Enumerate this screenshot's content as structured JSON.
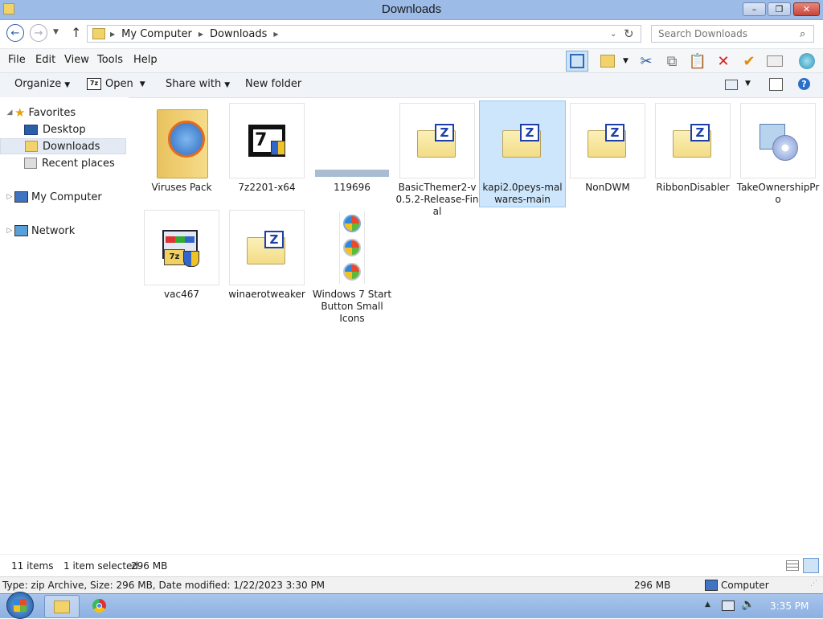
{
  "window": {
    "title": "Downloads",
    "controls": {
      "minimize": "–",
      "restore": "❐",
      "close": "✕"
    }
  },
  "address": {
    "crumbs": [
      "My Computer",
      "Downloads"
    ],
    "search_placeholder": "Search Downloads"
  },
  "menu": [
    "File",
    "Edit",
    "View",
    "Tools",
    "Help"
  ],
  "commands": {
    "organize": "Organize",
    "open": "Open",
    "share": "Share with",
    "new_folder": "New folder"
  },
  "nav": {
    "favorites": "Favorites",
    "desktop": "Desktop",
    "downloads": "Downloads",
    "recent": "Recent places",
    "computer": "My Computer",
    "network": "Network"
  },
  "files": [
    {
      "name": "Viruses Pack",
      "icon": "folder-browser-icon"
    },
    {
      "name": "7z2201-x64",
      "icon": "7zip-installer-icon"
    },
    {
      "name": "119696",
      "icon": "image-thumbnail-icon"
    },
    {
      "name": "BasicThemer2-v0.5.2-Release-Final",
      "icon": "zip-folder-icon"
    },
    {
      "name": "kapi2.0peys-malwares-main",
      "icon": "zip-folder-icon",
      "selected": true
    },
    {
      "name": "NonDWM",
      "icon": "zip-folder-icon"
    },
    {
      "name": "RibbonDisabler",
      "icon": "zip-folder-icon"
    },
    {
      "name": "TakeOwnershipPro",
      "icon": "setup-cd-icon"
    },
    {
      "name": "vac467",
      "icon": "7zip-app-icon"
    },
    {
      "name": "winaerotweaker",
      "icon": "zip-folder-icon"
    },
    {
      "name": "Windows 7 Start Button Small Icons",
      "icon": "start-orbs-icon"
    }
  ],
  "status": {
    "items": "11 items",
    "selected": "1 item selected",
    "size": "296 MB",
    "details": "Type: zip Archive, Size: 296 MB, Date modified: 1/22/2023 3:30 PM",
    "size2": "296 MB",
    "location": "Computer"
  },
  "taskbar": {
    "time": "3:35 PM"
  },
  "colors": {
    "selection": "#cde6fb",
    "titlebar": "#9cbbe6",
    "taskbar": "#8cb0e2"
  }
}
